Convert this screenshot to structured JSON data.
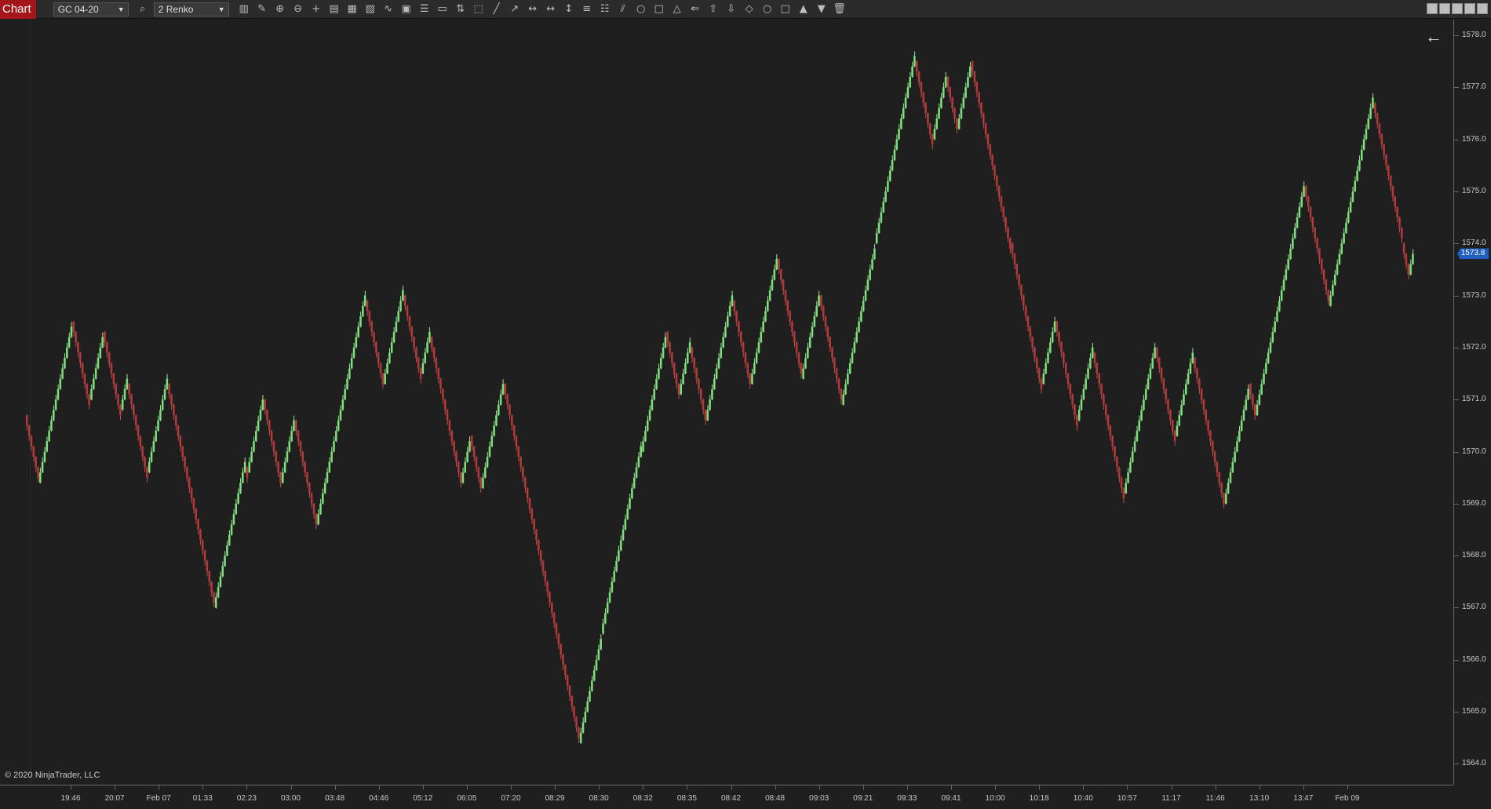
{
  "toolbar": {
    "tab_label": "Chart",
    "instrument": "GC 04-20",
    "bar_type": "2 Renko",
    "icons": [
      "search-icon",
      "bars-icon",
      "pencil-icon",
      "zoom-in-icon",
      "zoom-out-icon",
      "crosshair-icon",
      "properties-icon",
      "templates-icon",
      "indicators-icon",
      "strategies-icon",
      "data-box-icon",
      "list-icon",
      "ruler-icon",
      "arrows-icon",
      "rectangle-select-icon",
      "line-icon",
      "ray-icon",
      "extended-line-icon",
      "horizontal-line-icon",
      "vertical-line-icon",
      "lines-icon",
      "fib-icon",
      "channel-icon",
      "ellipse-icon",
      "rectangle-icon",
      "triangle-icon",
      "arrow-line-icon",
      "arrow-up-icon",
      "arrow-down-icon",
      "diamond-icon",
      "dot-icon",
      "square-icon",
      "triangle-up-icon",
      "triangle-down-icon",
      "trash-icon"
    ]
  },
  "colors": {
    "up": "#7ee07a",
    "down": "#b3393b",
    "wick_up": "#9be59a",
    "wick_down": "#c0504d",
    "last_price_bg": "#1f5fbf",
    "background": "#1f1f1f"
  },
  "copyright": "© 2020 NinjaTrader, LLC",
  "last_price": "1573.8",
  "price_axis": [
    "1578.0",
    "1577.0",
    "1576.0",
    "1575.0",
    "1574.0",
    "1573.0",
    "1572.0",
    "1571.0",
    "1570.0",
    "1569.0",
    "1568.0",
    "1567.0",
    "1566.0",
    "1565.0",
    "1564.0"
  ],
  "time_axis": [
    "19:46",
    "20:07",
    "Feb 07",
    "01:33",
    "02:23",
    "03:00",
    "03:48",
    "04:46",
    "05:12",
    "06:05",
    "07:20",
    "08:29",
    "08:30",
    "08:32",
    "08:35",
    "08:42",
    "08:48",
    "09:03",
    "09:21",
    "09:33",
    "09:41",
    "10:00",
    "10:18",
    "10:40",
    "10:57",
    "11:17",
    "11:46",
    "13:10",
    "13:47",
    "Feb 09"
  ],
  "chart_data": {
    "type": "renko",
    "instrument": "GC 04-20",
    "bar_type": "2 Renko",
    "ylim": [
      1563.6,
      1578.3
    ],
    "path": [
      1570.7,
      1569.4,
      1572.5,
      1571.0,
      1572.3,
      1570.8,
      1571.3,
      1569.6,
      1571.3,
      1567.0,
      1569.7,
      1569.6,
      1570.4,
      1571.0,
      1569.4,
      1570.6,
      1568.6,
      1571.0,
      1572.9,
      1571.3,
      1573.0,
      1571.5,
      1572.2,
      1570.4,
      1569.4,
      1570.3,
      1569.3,
      1571.3,
      1569.3,
      1564.4,
      1566.5,
      1570.0,
      1572.3,
      1571.1,
      1572.0,
      1570.6,
      1572.9,
      1571.3,
      1573.7,
      1571.4,
      1573.0,
      1570.9,
      1574.0,
      1576.8,
      1577.5,
      1576.0,
      1577.2,
      1576.2,
      1577.5,
      1574.0,
      1573.0,
      1571.3,
      1572.5,
      1570.6,
      1571.9,
      1569.2,
      1572.0,
      1570.3,
      1571.8,
      1569.0,
      1570.0,
      1571.3,
      1570.7,
      1575.1,
      1572.8,
      1576.7,
      1575.3,
      1574.0,
      1573.4,
      1573.8
    ]
  }
}
